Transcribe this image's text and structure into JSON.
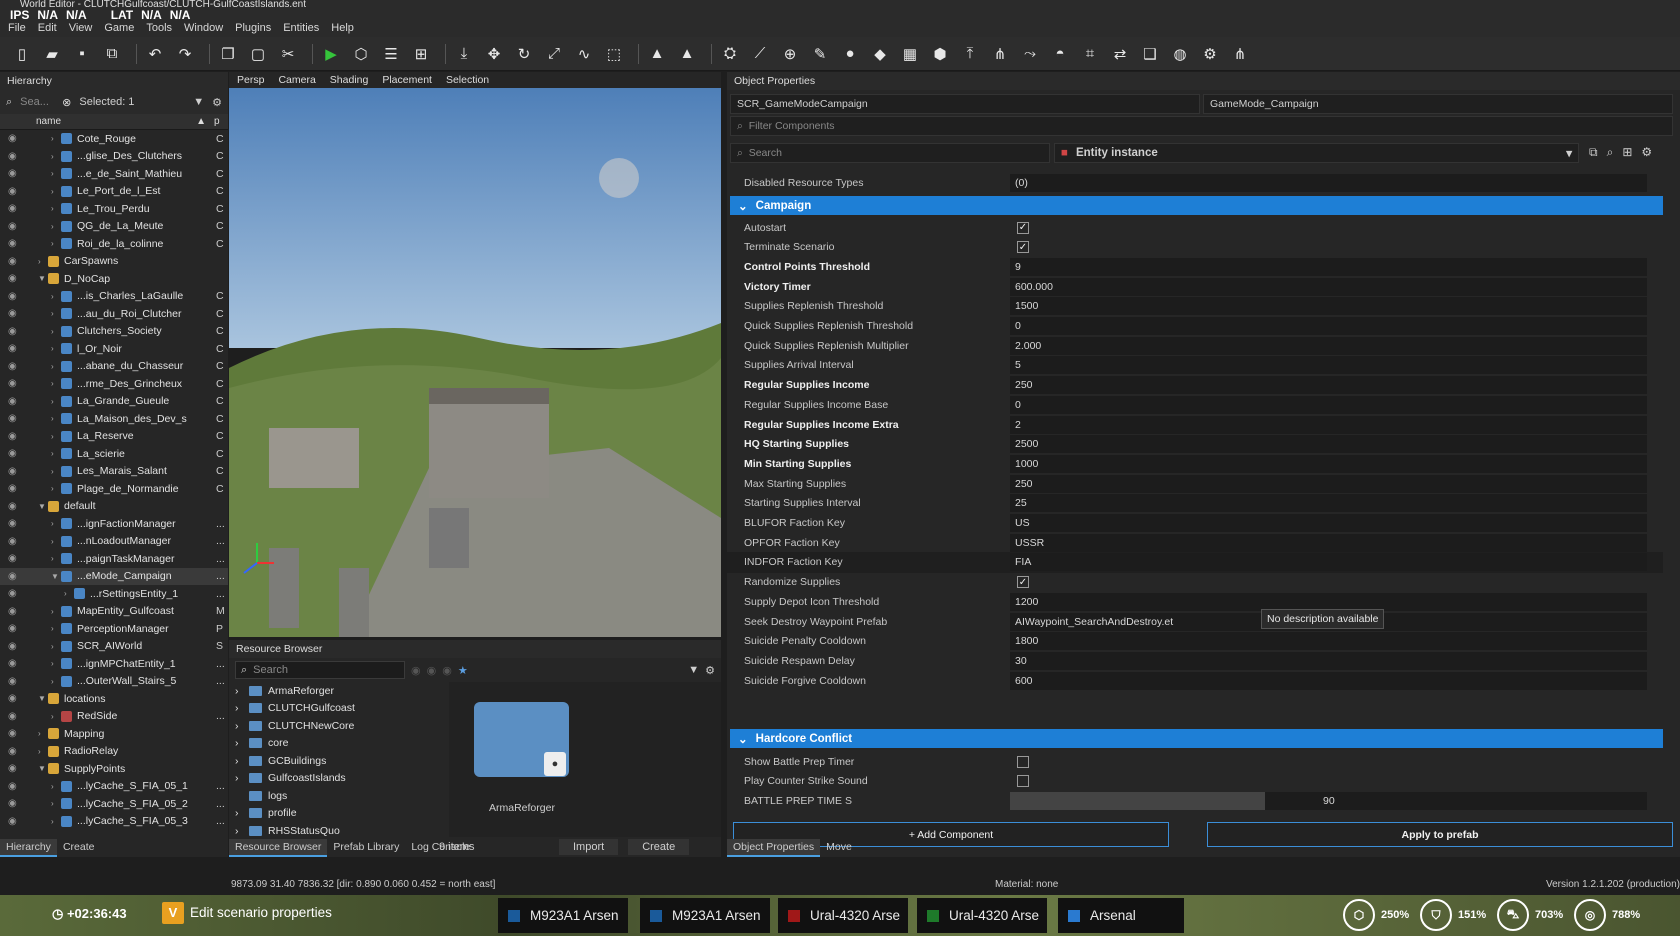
{
  "window_title": "World Editor - CLUTCHGulfcoast/CLUTCH-GulfCoastIslands.ent",
  "hud": {
    "ips": "IPS",
    "ips_val": "N/A",
    "na2": "N/A",
    "lat": "LAT",
    "lat_val": "N/A",
    "na4": "N/A"
  },
  "menu": [
    "File",
    "Edit",
    "View",
    "Game",
    "Tools",
    "Window",
    "Plugins",
    "Entities",
    "Help"
  ],
  "hierarchy": {
    "title": "Hierarchy",
    "search_placeholder": "Sea...",
    "selected": "Selected: 1",
    "col_name": "name",
    "col_p": "p",
    "rows": [
      {
        "name": "Cote_Rouge",
        "c": "C",
        "lvl": 2,
        "kind": "ent"
      },
      {
        "name": "...glise_Des_Clutchers",
        "c": "C",
        "lvl": 2,
        "kind": "ent"
      },
      {
        "name": "...e_de_Saint_Mathieu",
        "c": "C",
        "lvl": 2,
        "kind": "ent"
      },
      {
        "name": "Le_Port_de_l_Est",
        "c": "C",
        "lvl": 2,
        "kind": "ent"
      },
      {
        "name": "Le_Trou_Perdu",
        "c": "C",
        "lvl": 2,
        "kind": "ent"
      },
      {
        "name": "QG_de_La_Meute",
        "c": "C",
        "lvl": 2,
        "kind": "ent"
      },
      {
        "name": "Roi_de_la_colinne",
        "c": "C",
        "lvl": 2,
        "kind": "ent"
      },
      {
        "name": "CarSpawns",
        "c": "",
        "lvl": 1,
        "kind": "fld"
      },
      {
        "name": "D_NoCap",
        "c": "",
        "lvl": 1,
        "kind": "fld",
        "open": true
      },
      {
        "name": "...is_Charles_LaGaulle",
        "c": "C",
        "lvl": 2,
        "kind": "ent"
      },
      {
        "name": "...au_du_Roi_Clutcher",
        "c": "C",
        "lvl": 2,
        "kind": "ent"
      },
      {
        "name": "Clutchers_Society",
        "c": "C",
        "lvl": 2,
        "kind": "ent"
      },
      {
        "name": "l_Or_Noir",
        "c": "C",
        "lvl": 2,
        "kind": "ent"
      },
      {
        "name": "...abane_du_Chasseur",
        "c": "C",
        "lvl": 2,
        "kind": "ent"
      },
      {
        "name": "...rme_Des_Grincheux",
        "c": "C",
        "lvl": 2,
        "kind": "ent"
      },
      {
        "name": "La_Grande_Gueule",
        "c": "C",
        "lvl": 2,
        "kind": "ent"
      },
      {
        "name": "La_Maison_des_Dev_s",
        "c": "C",
        "lvl": 2,
        "kind": "ent"
      },
      {
        "name": "La_Reserve",
        "c": "C",
        "lvl": 2,
        "kind": "ent"
      },
      {
        "name": "La_scierie",
        "c": "C",
        "lvl": 2,
        "kind": "ent"
      },
      {
        "name": "Les_Marais_Salant",
        "c": "C",
        "lvl": 2,
        "kind": "ent"
      },
      {
        "name": "Plage_de_Normandie",
        "c": "C",
        "lvl": 2,
        "kind": "ent"
      },
      {
        "name": "default",
        "c": "",
        "lvl": 1,
        "kind": "fld",
        "open": true
      },
      {
        "name": "...ignFactionManager",
        "c": "...",
        "lvl": 2,
        "kind": "ent"
      },
      {
        "name": "...nLoadoutManager",
        "c": "...",
        "lvl": 2,
        "kind": "ent"
      },
      {
        "name": "...paignTaskManager",
        "c": "...",
        "lvl": 2,
        "kind": "ent"
      },
      {
        "name": "...eMode_Campaign",
        "c": "...",
        "lvl": 2,
        "kind": "ent",
        "open": true,
        "sel": true
      },
      {
        "name": "...rSettingsEntity_1",
        "c": "...",
        "lvl": 3,
        "kind": "ent"
      },
      {
        "name": "MapEntity_Gulfcoast",
        "c": "M",
        "lvl": 2,
        "kind": "ent"
      },
      {
        "name": "PerceptionManager",
        "c": "P",
        "lvl": 2,
        "kind": "ent"
      },
      {
        "name": "SCR_AIWorld",
        "c": "S",
        "lvl": 2,
        "kind": "ent"
      },
      {
        "name": "...ignMPChatEntity_1",
        "c": "...",
        "lvl": 2,
        "kind": "ent"
      },
      {
        "name": "...OuterWall_Stairs_5",
        "c": "...",
        "lvl": 2,
        "kind": "ent"
      },
      {
        "name": "locations",
        "c": "",
        "lvl": 1,
        "kind": "fld",
        "open": true
      },
      {
        "name": "RedSide",
        "c": "...",
        "lvl": 2,
        "kind": "red"
      },
      {
        "name": "Mapping",
        "c": "",
        "lvl": 1,
        "kind": "fld"
      },
      {
        "name": "RadioRelay",
        "c": "",
        "lvl": 1,
        "kind": "fld"
      },
      {
        "name": "SupplyPoints",
        "c": "",
        "lvl": 1,
        "kind": "fld",
        "open": true
      },
      {
        "name": "...lyCache_S_FIA_05_1",
        "c": "...",
        "lvl": 2,
        "kind": "ent"
      },
      {
        "name": "...lyCache_S_FIA_05_2",
        "c": "...",
        "lvl": 2,
        "kind": "ent"
      },
      {
        "name": "...lyCache_S_FIA_05_3",
        "c": "...",
        "lvl": 2,
        "kind": "ent"
      }
    ],
    "tabs": [
      "Hierarchy",
      "Create"
    ]
  },
  "viewport": {
    "tabs": [
      "Persp",
      "Camera",
      "Shading",
      "Placement",
      "Selection"
    ]
  },
  "resource_browser": {
    "title": "Resource Browser",
    "search_placeholder": "Search",
    "folders": [
      "ArmaReforger",
      "CLUTCHGulfcoast",
      "CLUTCHNewCore",
      "core",
      "GCBuildings",
      "GulfcoastIslands",
      "logs",
      "profile",
      "RHSStatusQuo"
    ],
    "preview_label": "ArmaReforger",
    "items_count": "9 items",
    "import_label": "Import",
    "create_label": "Create",
    "tabs": [
      "Resource Browser",
      "Prefab Library",
      "Log Console"
    ]
  },
  "object_properties": {
    "title": "Object Properties",
    "class_field": "SCR_GameModeCampaign",
    "name_field": "GameMode_Campaign",
    "filter_placeholder": "Filter Components",
    "search_placeholder": "Search",
    "entity_instance": "Entity instance",
    "disabled_resource_label": "Disabled Resource Types",
    "disabled_resource_value": "(0)",
    "campaign_section": "Campaign",
    "props": [
      {
        "label": "Autostart",
        "value": "",
        "check": true,
        "bold": false
      },
      {
        "label": "Terminate Scenario",
        "value": "",
        "check": true,
        "bold": false
      },
      {
        "label": "Control Points Threshold",
        "value": "9",
        "bold": true
      },
      {
        "label": "Victory Timer",
        "value": "600.000",
        "bold": true
      },
      {
        "label": "Supplies Replenish Threshold",
        "value": "1500",
        "bold": false
      },
      {
        "label": "Quick Supplies Replenish Threshold",
        "value": "0",
        "bold": false
      },
      {
        "label": "Quick Supplies Replenish Multiplier",
        "value": "2.000",
        "bold": false
      },
      {
        "label": "Supplies Arrival Interval",
        "value": "5",
        "bold": false
      },
      {
        "label": "Regular Supplies Income",
        "value": "250",
        "bold": true
      },
      {
        "label": "Regular Supplies Income Base",
        "value": "0",
        "bold": false
      },
      {
        "label": "Regular Supplies Income Extra",
        "value": "2",
        "bold": true
      },
      {
        "label": "HQ Starting Supplies",
        "value": "2500",
        "bold": true
      },
      {
        "label": "Min Starting Supplies",
        "value": "1000",
        "bold": true
      },
      {
        "label": "Max Starting Supplies",
        "value": "250",
        "bold": false
      },
      {
        "label": "Starting Supplies Interval",
        "value": "25",
        "bold": false
      },
      {
        "label": "BLUFOR Faction Key",
        "value": "US",
        "bold": false
      },
      {
        "label": "OPFOR Faction Key",
        "value": "USSR",
        "bold": false
      },
      {
        "label": "INDFOR Faction Key",
        "value": "FIA",
        "bold": false,
        "hl": true
      },
      {
        "label": "Randomize Supplies",
        "value": "",
        "check": true,
        "bold": false
      },
      {
        "label": "Supply Depot Icon Threshold",
        "value": "1200",
        "bold": false
      },
      {
        "label": "Seek Destroy Waypoint Prefab",
        "value": "AIWaypoint_SearchAndDestroy.et",
        "bold": false
      },
      {
        "label": "Suicide Penalty Cooldown",
        "value": "1800",
        "bold": false
      },
      {
        "label": "Suicide Respawn Delay",
        "value": "30",
        "bold": false
      },
      {
        "label": "Suicide Forgive Cooldown",
        "value": "600",
        "bold": false
      }
    ],
    "hardcore_section": "Hardcore Conflict",
    "hardcore_props": [
      {
        "label": "Show Battle Prep Timer",
        "value": "",
        "check": false
      },
      {
        "label": "Play Counter Strike Sound",
        "value": "",
        "check": false
      },
      {
        "label": "BATTLE PREP TIME S",
        "value": "90",
        "slider": 0.4
      }
    ],
    "tooltip": "No description available",
    "add_component": "+ Add Component",
    "apply_prefab": "Apply to prefab",
    "tabs": [
      "Object Properties",
      "Move"
    ]
  },
  "status": {
    "coords": "9873.09    31.40    7836.32 [dir: 0.890  0.060  0.452 = north east]",
    "material": "Material: none",
    "version": "Version 1.2.1.202 (production)"
  },
  "taskbar": {
    "timer": "+02:36:43",
    "scenario": "Edit scenario properties",
    "v_key": "V",
    "items": [
      {
        "label": "M923A1 Arsen",
        "color": "#1a5a9a"
      },
      {
        "label": "M923A1 Arsen",
        "color": "#1a5a9a"
      },
      {
        "label": "Ural-4320 Arse",
        "color": "#a01818"
      },
      {
        "label": "Ural-4320 Arse",
        "color": "#1e7a2a"
      },
      {
        "label": "Arsenal",
        "color": "#2a7ad0"
      }
    ],
    "gauges": [
      {
        "icon": "supply-icon",
        "glyph": "⬡",
        "value": "250%"
      },
      {
        "icon": "squad-icon",
        "glyph": "⛉",
        "value": "151%"
      },
      {
        "icon": "vehicle-icon",
        "glyph": "⛍",
        "value": "703%"
      },
      {
        "icon": "base-icon",
        "glyph": "◎",
        "value": "788%"
      }
    ]
  }
}
